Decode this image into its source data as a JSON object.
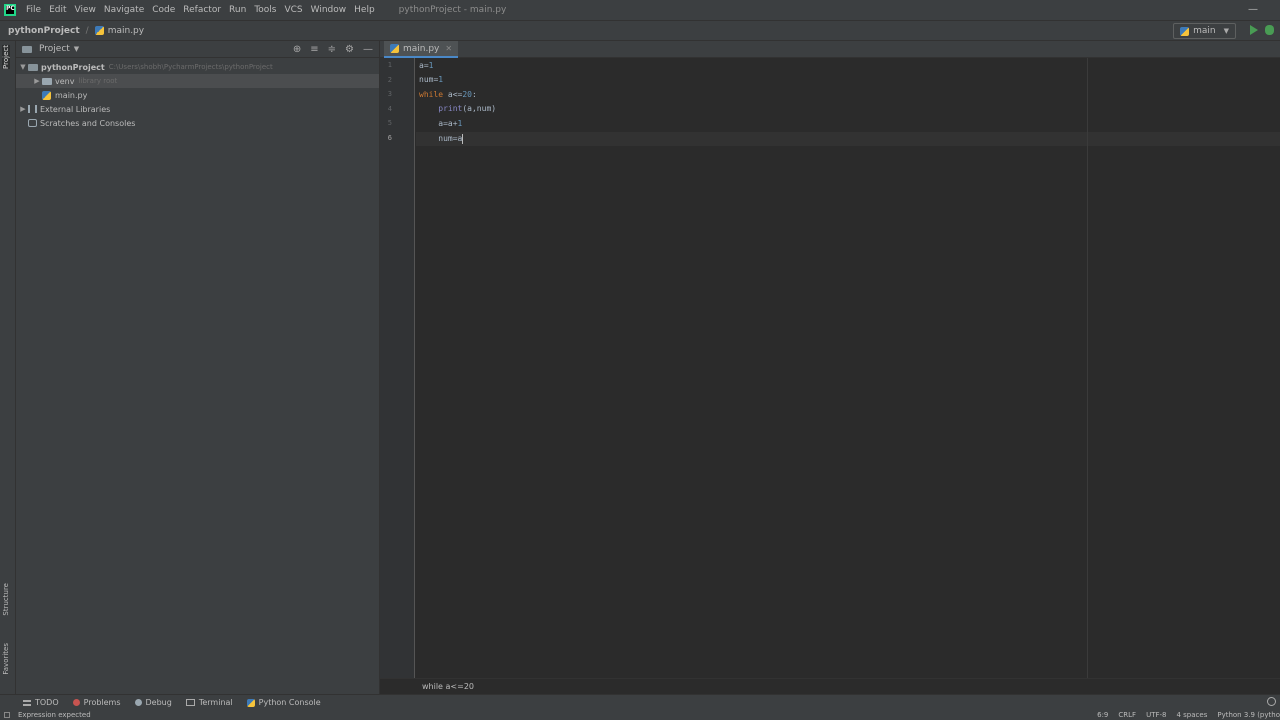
{
  "app": {
    "logo_text": "PC",
    "window_title": "pythonProject - main.py",
    "minimize_glyph": "—"
  },
  "menu": [
    "File",
    "Edit",
    "View",
    "Navigate",
    "Code",
    "Refactor",
    "Run",
    "Tools",
    "VCS",
    "Window",
    "Help"
  ],
  "breadcrumb": {
    "project": "pythonProject",
    "file": "main.py"
  },
  "run_config": {
    "label": "main"
  },
  "project_panel": {
    "title": "Project",
    "tree": [
      {
        "label": "pythonProject",
        "hint": "C:\\Users\\shobh\\PycharmProjects\\pythonProject",
        "level": 0,
        "expanded": true,
        "icon": "folder-icon",
        "bold": true
      },
      {
        "label": "venv",
        "hint": "library root",
        "level": 1,
        "expanded": false,
        "icon": "folder-icon",
        "selected": true
      },
      {
        "label": "main.py",
        "hint": "",
        "level": 1,
        "icon": "python-file-icon"
      },
      {
        "label": "External Libraries",
        "hint": "",
        "level": 0,
        "expanded": false,
        "icon": "library-icon"
      },
      {
        "label": "Scratches and Consoles",
        "hint": "",
        "level": 0,
        "icon": "scratches-icon"
      }
    ]
  },
  "left_strip": {
    "project": "Project",
    "structure": "Structure",
    "favorites": "Favorites"
  },
  "editor": {
    "tab": "main.py",
    "line_numbers": [
      "1",
      "2",
      "3",
      "4",
      "5",
      "6"
    ],
    "lines": [
      "a=1",
      "num=1",
      "while a<=20:",
      "    print(a,num)",
      "    a=a+1",
      "    num=a"
    ],
    "current_line": 6,
    "caret_position": "6:9",
    "scope_crumb": "while a<=20"
  },
  "bottom_tools": [
    "TODO",
    "Problems",
    "Debug",
    "Terminal",
    "Python Console"
  ],
  "status": {
    "message": "Expression expected",
    "position": "6:9",
    "line_sep": "CRLF",
    "encoding": "UTF-8",
    "indent": "4 spaces",
    "interpreter": "Python 3.9 (pytho"
  },
  "colors": {
    "keyword": "#cc7832",
    "number": "#6897bb",
    "builtin": "#8888c6",
    "default_code": "#a9b7c6",
    "run_green": "#499c54",
    "error_red": "#c75450"
  }
}
